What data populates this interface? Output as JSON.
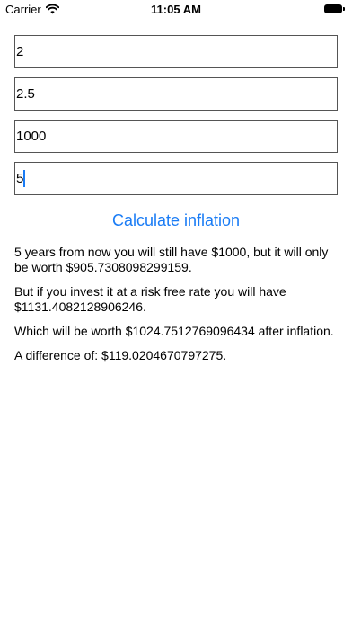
{
  "status_bar": {
    "carrier": "Carrier",
    "time": "11:05 AM"
  },
  "inputs": {
    "field_1_value": "2",
    "field_2_value": "2.5",
    "field_3_value": "1000",
    "field_4_value": "5"
  },
  "button": {
    "calculate_label": "Calculate inflation"
  },
  "results": {
    "line_1": "5 years from now you will still have $1000, but it will only be worth $905.7308098299159.",
    "line_2": "But if you invest it at a risk free rate you will have $1131.4082128906246.",
    "line_3": "Which will be worth $1024.7512769096434 after inflation.",
    "line_4": "A difference of: $119.0204670797275."
  },
  "colors": {
    "accent": "#1a7cf5",
    "field_border": "#555555",
    "background": "#ffffff"
  },
  "icons": {
    "wifi": "wifi-icon",
    "battery": "battery-icon"
  }
}
